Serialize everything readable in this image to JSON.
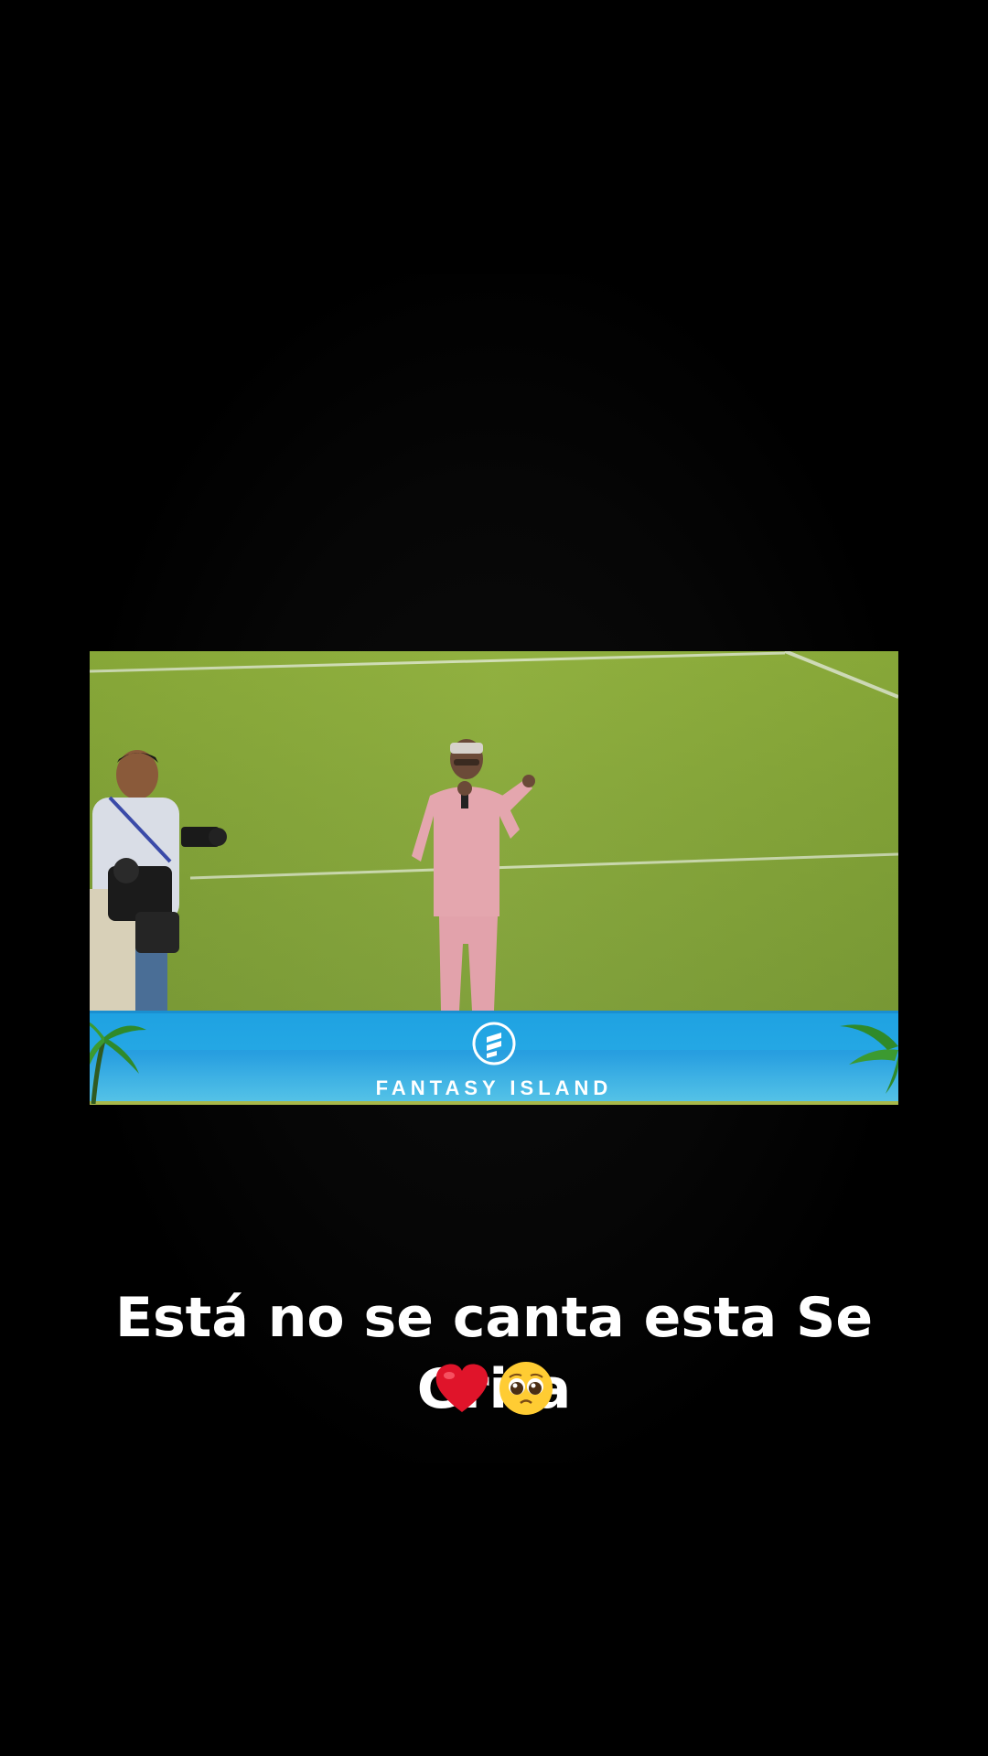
{
  "video": {
    "banner_brand": "FANTASY ISLAND",
    "banner_logo_icon": "fantasy-island-logo-icon"
  },
  "caption": {
    "line1": "Está no se canta esta Se Grita",
    "emoji_icons": [
      "red-heart-icon",
      "pleading-face-icon"
    ]
  },
  "colors": {
    "background": "#000000",
    "pitch_green": "#86a63a",
    "banner_blue": "#25a8e4",
    "caption_text": "#ffffff"
  }
}
